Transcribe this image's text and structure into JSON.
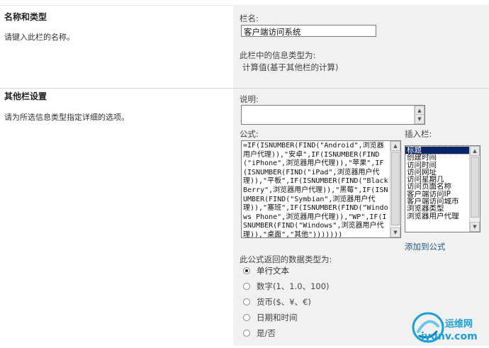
{
  "section_name": {
    "title": "名称和类型",
    "description": "请键入此栏的名称。",
    "column_name_label": "栏名:",
    "column_name_value": "客户端访问系统",
    "type_label": "此栏中的信息类型为:",
    "type_value": "计算值(基于其他栏的计算)"
  },
  "section_settings": {
    "title": "其他栏设置",
    "description": "请为所选信息类型指定详细的选项。",
    "description_label": "说明:",
    "formula_label": "公式:",
    "formula_value": "=IF(ISNUMBER(FIND(\"Android\",浏览器用户代理)),\"安卓\",IF(ISNUMBER(FIND(\"iPhone\",浏览器用户代理)),\"苹果\",IF(ISNUMBER(FIND(\"iPad\",浏览器用户代理)),\"平板\",IF(ISNUMBER(FIND(\"BlackBerry\",浏览器用户代理)),\"黑莓\",IF(ISNUMBER(FIND(\"Symbian\",浏览器用户代理)),\"塞班\",IF(ISNUMBER(FIND(\"Windows Phone\",浏览器用户代理)),\"WP\",IF(ISNUMBER(FIND(\"Windows\",浏览器用户代理)),\"桌面\",\"其他\")))))))",
    "insert_column_label": "插入栏:",
    "columns": [
      "标题",
      "创建时间",
      "访问时间",
      "访问网址",
      "访问星期几",
      "访问页面名称",
      "客户端访问IP",
      "客户端访问城市",
      "浏览器类型",
      "浏览器用户代理"
    ],
    "add_to_formula_link": "添加到公式",
    "return_type_label": "此公式返回的数据类型为:",
    "return_types": [
      {
        "label": "单行文本",
        "selected": true
      },
      {
        "label": "数字(1、1.0、100)",
        "selected": false
      },
      {
        "label": "货币($、¥、€)",
        "selected": false
      },
      {
        "label": "日期和时间",
        "selected": false
      },
      {
        "label": "是/否",
        "selected": false
      }
    ]
  },
  "watermark": {
    "text_cn": "运维网",
    "text_en": "iyunv.com"
  },
  "colors": {
    "panel_bg": "#f1f1f1",
    "selection_bg": "#0a246a",
    "link": "#1f5c8b",
    "watermark_blue": "#1a9fd9"
  }
}
